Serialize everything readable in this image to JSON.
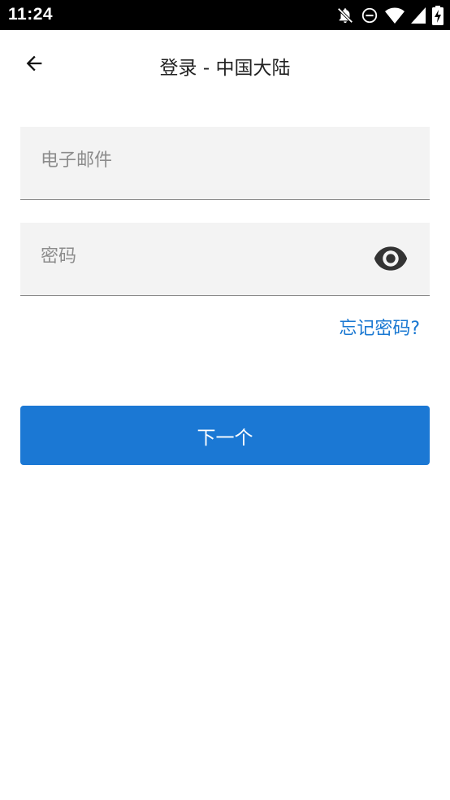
{
  "status_bar": {
    "time": "11:24",
    "icons": [
      "bell-off-icon",
      "do-not-disturb-icon",
      "wifi-icon",
      "signal-icon",
      "battery-charging-icon"
    ]
  },
  "app_bar": {
    "back_icon": "arrow-left-icon",
    "title": "登录 - 中国大陆"
  },
  "form": {
    "email": {
      "placeholder": "电子邮件",
      "value": ""
    },
    "password": {
      "placeholder": "密码",
      "value": "",
      "toggle_icon": "eye-icon"
    },
    "forgot_password": "忘记密码?",
    "next_button": "下一个"
  },
  "colors": {
    "accent": "#1b78d4",
    "link": "#1a78d2",
    "field_background": "#f3f3f3",
    "status_bar": "#000000"
  }
}
